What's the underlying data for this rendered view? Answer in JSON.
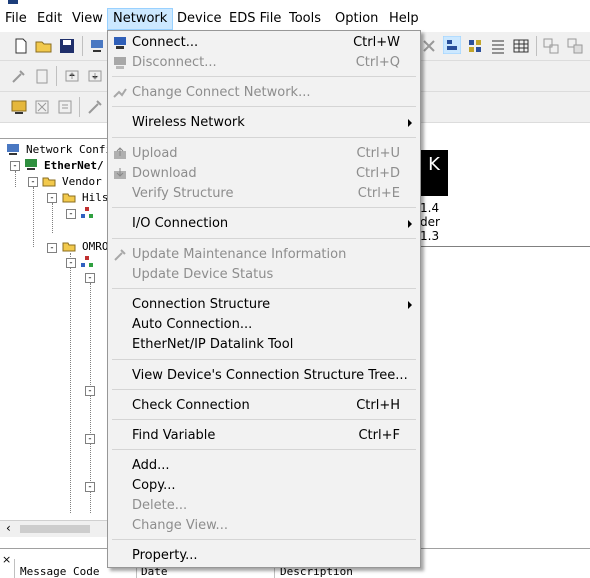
{
  "menubar": {
    "items": [
      {
        "label": "File"
      },
      {
        "label": "Edit"
      },
      {
        "label": "View"
      },
      {
        "label": "Network",
        "active": true
      },
      {
        "label": "Device"
      },
      {
        "label": "EDS File"
      },
      {
        "label": "Tools"
      },
      {
        "label": "Option"
      },
      {
        "label": "Help"
      }
    ]
  },
  "tree": {
    "root": "Network Confi",
    "network": "EtherNet/",
    "vendor": "Vendor",
    "hils": "Hils",
    "omron": "OMRO"
  },
  "device_panel": {
    "image_letter": "K",
    "line1": "1.4",
    "line2": "der",
    "line3": "1.3"
  },
  "message_bar": {
    "col1": "Message Code",
    "col2": "Date",
    "col3": "Description"
  },
  "network_menu": {
    "connect": {
      "label": "Connect...",
      "shortcut": "Ctrl+W"
    },
    "disconnect": {
      "label": "Disconnect...",
      "shortcut": "Ctrl+Q"
    },
    "change_connect_network": {
      "label": "Change Connect Network..."
    },
    "wireless_network": {
      "label": "Wireless Network"
    },
    "upload": {
      "label": "Upload",
      "shortcut": "Ctrl+U"
    },
    "download": {
      "label": "Download",
      "shortcut": "Ctrl+D"
    },
    "verify_structure": {
      "label": "Verify Structure",
      "shortcut": "Ctrl+E"
    },
    "io_connection": {
      "label": "I/O Connection"
    },
    "update_maintenance": {
      "label": "Update Maintenance Information"
    },
    "update_device_status": {
      "label": "Update Device Status"
    },
    "connection_structure": {
      "label": "Connection Structure"
    },
    "auto_connection": {
      "label": "Auto Connection..."
    },
    "datalink_tool": {
      "label": "EtherNet/IP Datalink Tool"
    },
    "view_connection_tree": {
      "label": "View Device's Connection Structure Tree..."
    },
    "check_connection": {
      "label": "Check Connection",
      "shortcut": "Ctrl+H"
    },
    "find_variable": {
      "label": "Find Variable",
      "shortcut": "Ctrl+F"
    },
    "add": {
      "label": "Add..."
    },
    "copy": {
      "label": "Copy..."
    },
    "delete": {
      "label": "Delete..."
    },
    "change_view": {
      "label": "Change View..."
    },
    "property": {
      "label": "Property..."
    }
  },
  "icons": [
    "connect-icon",
    "disconnect-icon",
    "change-network-icon",
    "upload-icon",
    "download-icon",
    "update-maintenance-icon",
    "folder-icon",
    "device-icon",
    "chevron-right-icon"
  ],
  "colors": {
    "menu_bg": "#f2f2f2",
    "menu_active_bg": "#cce8ff",
    "disabled_text": "#8d8d8d",
    "toolbar_bg": "#f0f0f0"
  }
}
